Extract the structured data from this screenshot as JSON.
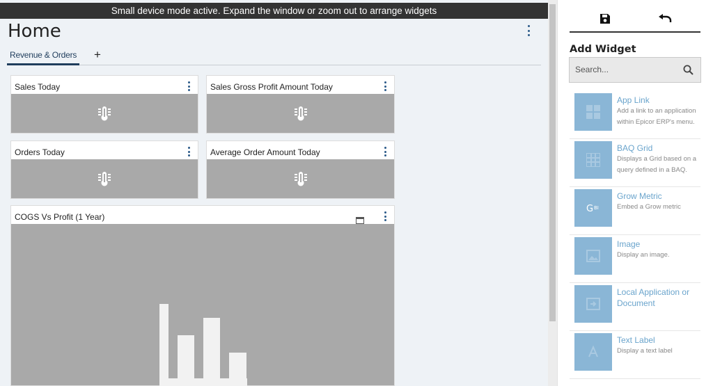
{
  "banner": {
    "text": "Small device mode active. Expand the window or zoom out to arrange widgets"
  },
  "page": {
    "title": "Home"
  },
  "tabs": [
    {
      "label": "Revenue & Orders",
      "active": true
    }
  ],
  "add_tab_label": "+",
  "widgets": [
    {
      "title": "Sales Today",
      "icon": "thermometer-icon"
    },
    {
      "title": "Sales Gross Profit Amount Today",
      "icon": "thermometer-icon"
    },
    {
      "title": "Orders Today",
      "icon": "thermometer-icon"
    },
    {
      "title": "Average Order Amount Today",
      "icon": "thermometer-icon"
    },
    {
      "title": "COGS Vs Profit (1 Year)",
      "icon": "bar-chart-icon"
    }
  ],
  "panel": {
    "title": "Add Widget",
    "search_placeholder": "Search...",
    "items": [
      {
        "name": "App Link",
        "description": "Add a link to an application within Epicor ERP's menu.",
        "icon": "grid-icon"
      },
      {
        "name": "BAQ Grid",
        "description": "Displays a Grid based on a query defined in a BAQ.",
        "icon": "table-icon"
      },
      {
        "name": "Grow Metric",
        "description": "Embed a Grow metric",
        "icon": "grow-bi-icon"
      },
      {
        "name": "Image",
        "description": "Display an image.",
        "icon": "image-icon"
      },
      {
        "name": "Local Application or Document",
        "description": "",
        "icon": "document-icon"
      },
      {
        "name": "Text Label",
        "description": "Display a text label",
        "icon": "text-icon"
      }
    ]
  },
  "colors": {
    "banner_bg": "#333333",
    "accent": "#1f3d5c",
    "widget_body": "#a9a9a9",
    "thumb": "#8ab6d6",
    "link_text": "#6aa4cc"
  }
}
